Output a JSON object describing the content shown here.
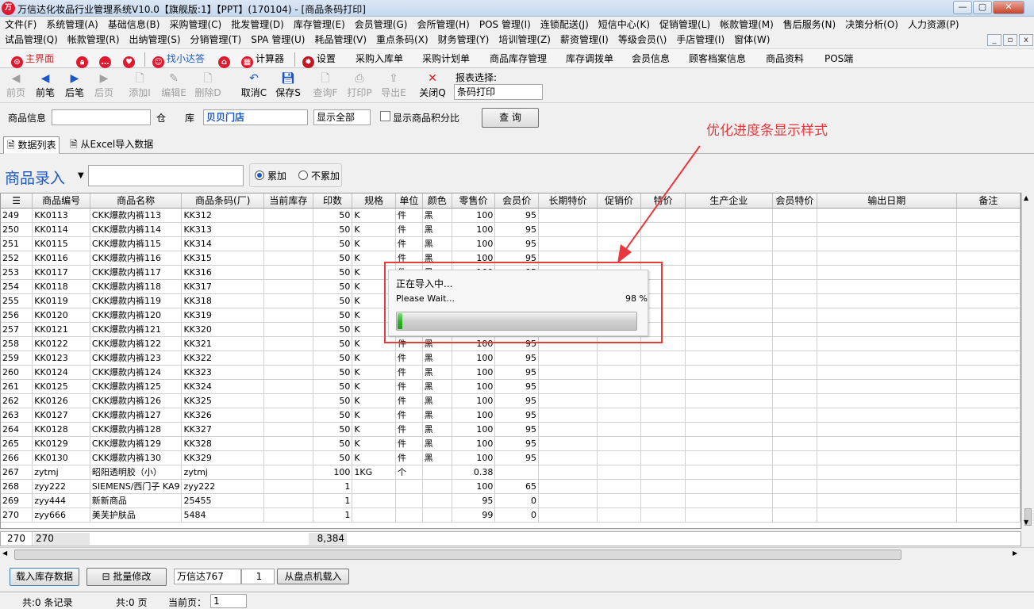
{
  "window": {
    "logo": "万",
    "title": "万信达化妆品行业管理系统V10.0【旗舰版:1】【PPT】(170104) - [商品条码打印]",
    "min_label": "—",
    "max_label": "▢",
    "close_label": "✕"
  },
  "menu_row1": [
    "文件(F)",
    "系统管理(A)",
    "基础信息(B)",
    "采购管理(C)",
    "批发管理(D)",
    "库存管理(E)",
    "会员管理(G)",
    "会所管理(H)",
    "POS 管理(I)",
    "连锁配送(J)",
    "短信中心(K)",
    "促销管理(L)",
    "帐款管理(M)",
    "售后服务(N)",
    "决策分析(O)",
    "人力资源(P)"
  ],
  "menu_row2": [
    "试品管理(Q)",
    "帐款管理(R)",
    "出纳管理(S)",
    "分销管理(T)",
    "SPA 管理(U)",
    "耗品管理(V)",
    "重点条码(X)",
    "财务管理(Y)",
    "培训管理(Z)",
    "薪资管理(I)",
    "等级会员(\\)",
    "手店管理(I)",
    "窗体(W)"
  ],
  "quick_toolbar": {
    "home": "主界面",
    "helper": "找小达答",
    "calculator": "计算器",
    "settings": "设置",
    "links": [
      "采购入库单",
      "采购计划单",
      "商品库存管理",
      "库存调拨单",
      "会员信息",
      "顾客档案信息",
      "商品资料",
      "POS端"
    ]
  },
  "action_toolbar": {
    "first": "前页",
    "prev": "前笔",
    "next": "后笔",
    "last": "后页",
    "add": "添加I",
    "edit": "编辑E",
    "delete": "删除D",
    "cancel": "取消C",
    "save": "保存S",
    "query": "查询F",
    "print": "打印P",
    "export": "导出E",
    "close": "关闭Q",
    "report_label": "报表选择:",
    "report_value": "条码打印"
  },
  "filter": {
    "product_label": "商品信息",
    "warehouse_label": "仓　　库",
    "warehouse_value": "贝贝门店",
    "show_value": "显示全部",
    "points_label": "显示商品积分比",
    "query_btn": "查 询"
  },
  "annotation": "优化进度条显示样式",
  "tabs": [
    "数据列表",
    "从Excel导入数据"
  ],
  "entry": {
    "title": "商品录入",
    "accumulate": "累加",
    "no_accumulate": "不累加",
    "accumulate_selected": true
  },
  "grid": {
    "headers": [
      "",
      "商品编号",
      "商品名称",
      "商品条码(厂)",
      "当前库存",
      "印数",
      "规格",
      "单位",
      "颜色",
      "零售价",
      "会员价",
      "长期特价",
      "促销价",
      "特价",
      "生产企业",
      "会员特价",
      "输出日期",
      "备注"
    ],
    "rows": [
      [
        "249",
        "KK0113",
        "CKK爆款内裤113",
        "KK312",
        "",
        "50",
        "K",
        "件",
        "黑",
        "100",
        "95"
      ],
      [
        "250",
        "KK0114",
        "CKK爆款内裤114",
        "KK313",
        "",
        "50",
        "K",
        "件",
        "黑",
        "100",
        "95"
      ],
      [
        "251",
        "KK0115",
        "CKK爆款内裤115",
        "KK314",
        "",
        "50",
        "K",
        "件",
        "黑",
        "100",
        "95"
      ],
      [
        "252",
        "KK0116",
        "CKK爆款内裤116",
        "KK315",
        "",
        "50",
        "K",
        "件",
        "黑",
        "100",
        "95"
      ],
      [
        "253",
        "KK0117",
        "CKK爆款内裤117",
        "KK316",
        "",
        "50",
        "K",
        "件",
        "黑",
        "100",
        "95"
      ],
      [
        "254",
        "KK0118",
        "CKK爆款内裤118",
        "KK317",
        "",
        "50",
        "K",
        "件",
        "黑",
        "100",
        "95"
      ],
      [
        "255",
        "KK0119",
        "CKK爆款内裤119",
        "KK318",
        "",
        "50",
        "K",
        "件",
        "黑",
        "100",
        "95"
      ],
      [
        "256",
        "KK0120",
        "CKK爆款内裤120",
        "KK319",
        "",
        "50",
        "K",
        "件",
        "黑",
        "100",
        "95"
      ],
      [
        "257",
        "KK0121",
        "CKK爆款内裤121",
        "KK320",
        "",
        "50",
        "K",
        "件",
        "黑",
        "100",
        "95"
      ],
      [
        "258",
        "KK0122",
        "CKK爆款内裤122",
        "KK321",
        "",
        "50",
        "K",
        "件",
        "黑",
        "100",
        "95"
      ],
      [
        "259",
        "KK0123",
        "CKK爆款内裤123",
        "KK322",
        "",
        "50",
        "K",
        "件",
        "黑",
        "100",
        "95"
      ],
      [
        "260",
        "KK0124",
        "CKK爆款内裤124",
        "KK323",
        "",
        "50",
        "K",
        "件",
        "黑",
        "100",
        "95"
      ],
      [
        "261",
        "KK0125",
        "CKK爆款内裤125",
        "KK324",
        "",
        "50",
        "K",
        "件",
        "黑",
        "100",
        "95"
      ],
      [
        "262",
        "KK0126",
        "CKK爆款内裤126",
        "KK325",
        "",
        "50",
        "K",
        "件",
        "黑",
        "100",
        "95"
      ],
      [
        "263",
        "KK0127",
        "CKK爆款内裤127",
        "KK326",
        "",
        "50",
        "K",
        "件",
        "黑",
        "100",
        "95"
      ],
      [
        "264",
        "KK0128",
        "CKK爆款内裤128",
        "KK327",
        "",
        "50",
        "K",
        "件",
        "黑",
        "100",
        "95"
      ],
      [
        "265",
        "KK0129",
        "CKK爆款内裤129",
        "KK328",
        "",
        "50",
        "K",
        "件",
        "黑",
        "100",
        "95"
      ],
      [
        "266",
        "KK0130",
        "CKK爆款内裤130",
        "KK329",
        "",
        "50",
        "K",
        "件",
        "黑",
        "100",
        "95"
      ],
      [
        "267",
        "zytmj",
        "昭阳透明胶（小）",
        "zytmj",
        "",
        "100",
        "1KG",
        "个",
        "",
        "0.38",
        ""
      ],
      [
        "268",
        "zyy222",
        "SIEMENS/西门子 KA9",
        "zyy222",
        "",
        "1",
        "",
        "",
        "",
        "100",
        "65"
      ],
      [
        "269",
        "zyy444",
        "新新商品",
        "25455",
        "",
        "1",
        "",
        "",
        "",
        "95",
        "0"
      ],
      [
        "270",
        "zyy666",
        "美芙护肤品",
        "5484",
        "",
        "1",
        "",
        "",
        "",
        "99",
        "0"
      ]
    ],
    "footer_count": "270",
    "footer_code": "270",
    "footer_total": "8,384"
  },
  "bottom": {
    "load_btn": "载入库存数据",
    "batch_btn": "批量修改",
    "device_name": "万信达767",
    "device_num": "1",
    "device_btn": "从盘点机载入"
  },
  "status": {
    "records": "共:0 条记录",
    "pages": "共:0 页",
    "current_label": "当前页：",
    "current_value": "1"
  },
  "progress": {
    "title": "正在导入中...",
    "subtitle": "Please Wait...",
    "percent_text": "98 %",
    "fill_fraction": 0.02
  },
  "colors": {
    "accent_blue": "#1b58c4",
    "annotation_red": "#e8383d",
    "progress_green": "#2fb62b"
  }
}
